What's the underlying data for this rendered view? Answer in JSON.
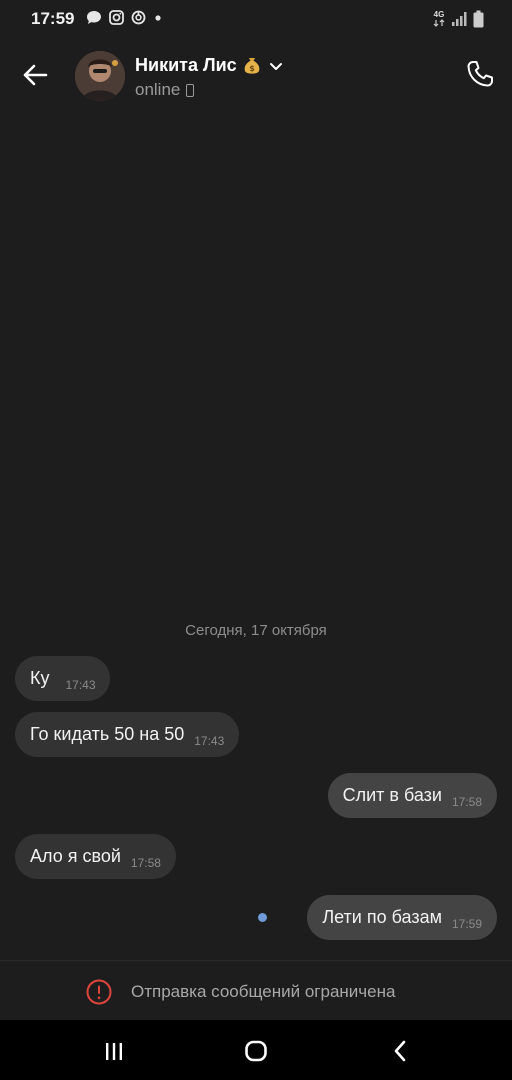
{
  "status_bar": {
    "time": "17:59",
    "network": "4G",
    "left_icons": [
      "chat-bubble-icon",
      "instagram-icon",
      "app-icon",
      "dot-icon"
    ],
    "right_icons": [
      "network-4g-icon",
      "signal-icon",
      "battery-icon"
    ]
  },
  "header": {
    "contact_name": "Никита Лис",
    "name_emoji": "money-bag-icon",
    "status": "online",
    "back_icon": "arrow-left-icon",
    "call_icon": "phone-call-icon"
  },
  "chat": {
    "date_separator": "Сегодня, 17 октября",
    "messages": [
      {
        "direction": "in",
        "text": "Ку",
        "time": "17:43"
      },
      {
        "direction": "in",
        "text": "Го кидать 50 на 50",
        "time": "17:43"
      },
      {
        "direction": "out",
        "text": "Слит в бази",
        "time": "17:58"
      },
      {
        "direction": "in",
        "text": "Ало я свой",
        "time": "17:58"
      },
      {
        "direction": "out",
        "text": "Лети по базам",
        "time": "17:59",
        "unread": true
      }
    ]
  },
  "restriction": {
    "icon": "alert-circle-icon",
    "text": "Отправка сообщений ограничена"
  },
  "nav_bar": {
    "buttons": [
      "recent-apps-icon",
      "home-icon",
      "back-icon"
    ]
  },
  "colors": {
    "background": "#1d1d1d",
    "incoming_bubble": "#333333",
    "outgoing_bubble": "#444444",
    "unread_dot": "#6f9ad7",
    "alert": "#e0453d"
  }
}
